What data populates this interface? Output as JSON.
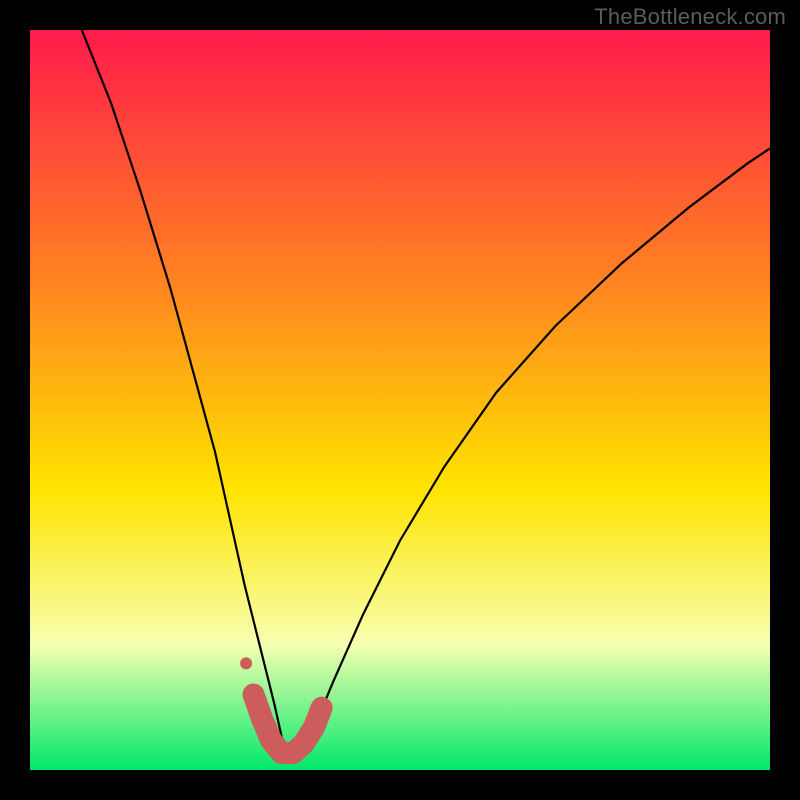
{
  "watermark": "TheBottleneck.com",
  "chart_data": {
    "type": "line",
    "title": "",
    "xlabel": "",
    "ylabel": "",
    "xlim": [
      0,
      100
    ],
    "ylim": [
      0,
      100
    ],
    "grid": false,
    "legend": false,
    "background_gradient": {
      "top": "#ff1a4b",
      "mid1": "#ff8a1e",
      "mid2": "#ffe400",
      "lower": "#f6ffb0",
      "bottom": "#00e86a"
    },
    "axes_visible": false,
    "notes": "No numeric axis ticks or labels are visible; x and y are normalized 0–100. The curve depicts a V-shaped response that drops from the top-left, bottoms near x≈34 at y≈2, and rises toward the top-right. Values are estimated from the plot geometry.",
    "series": [
      {
        "name": "curve",
        "stroke": "#000000",
        "stroke_width": 2.2,
        "x": [
          7,
          11,
          15,
          19,
          22,
          25,
          27,
          29,
          31,
          33,
          34.5,
          36.5,
          38.5,
          41,
          45,
          50,
          56,
          63,
          71,
          80,
          89,
          97,
          100
        ],
        "y": [
          100,
          90,
          78,
          65,
          54,
          43,
          34,
          25,
          17,
          9,
          2.3,
          2.3,
          6,
          12,
          21,
          31,
          41,
          51,
          60,
          68.5,
          76,
          82,
          84
        ]
      },
      {
        "name": "highlight-marker",
        "type": "thick-segment",
        "stroke": "#cd5c5c",
        "stroke_width": 14,
        "linecap": "round",
        "x": [
          30.2,
          31.4,
          32.6,
          34.0,
          35.6,
          37.0,
          38.4,
          39.4
        ],
        "y": [
          10.2,
          6.8,
          4.0,
          2.3,
          2.3,
          3.6,
          5.8,
          8.4
        ]
      },
      {
        "name": "highlight-dot",
        "type": "point",
        "fill": "#cd5c5c",
        "radius": 6,
        "x": [
          29.2
        ],
        "y": [
          14.4
        ]
      }
    ]
  }
}
